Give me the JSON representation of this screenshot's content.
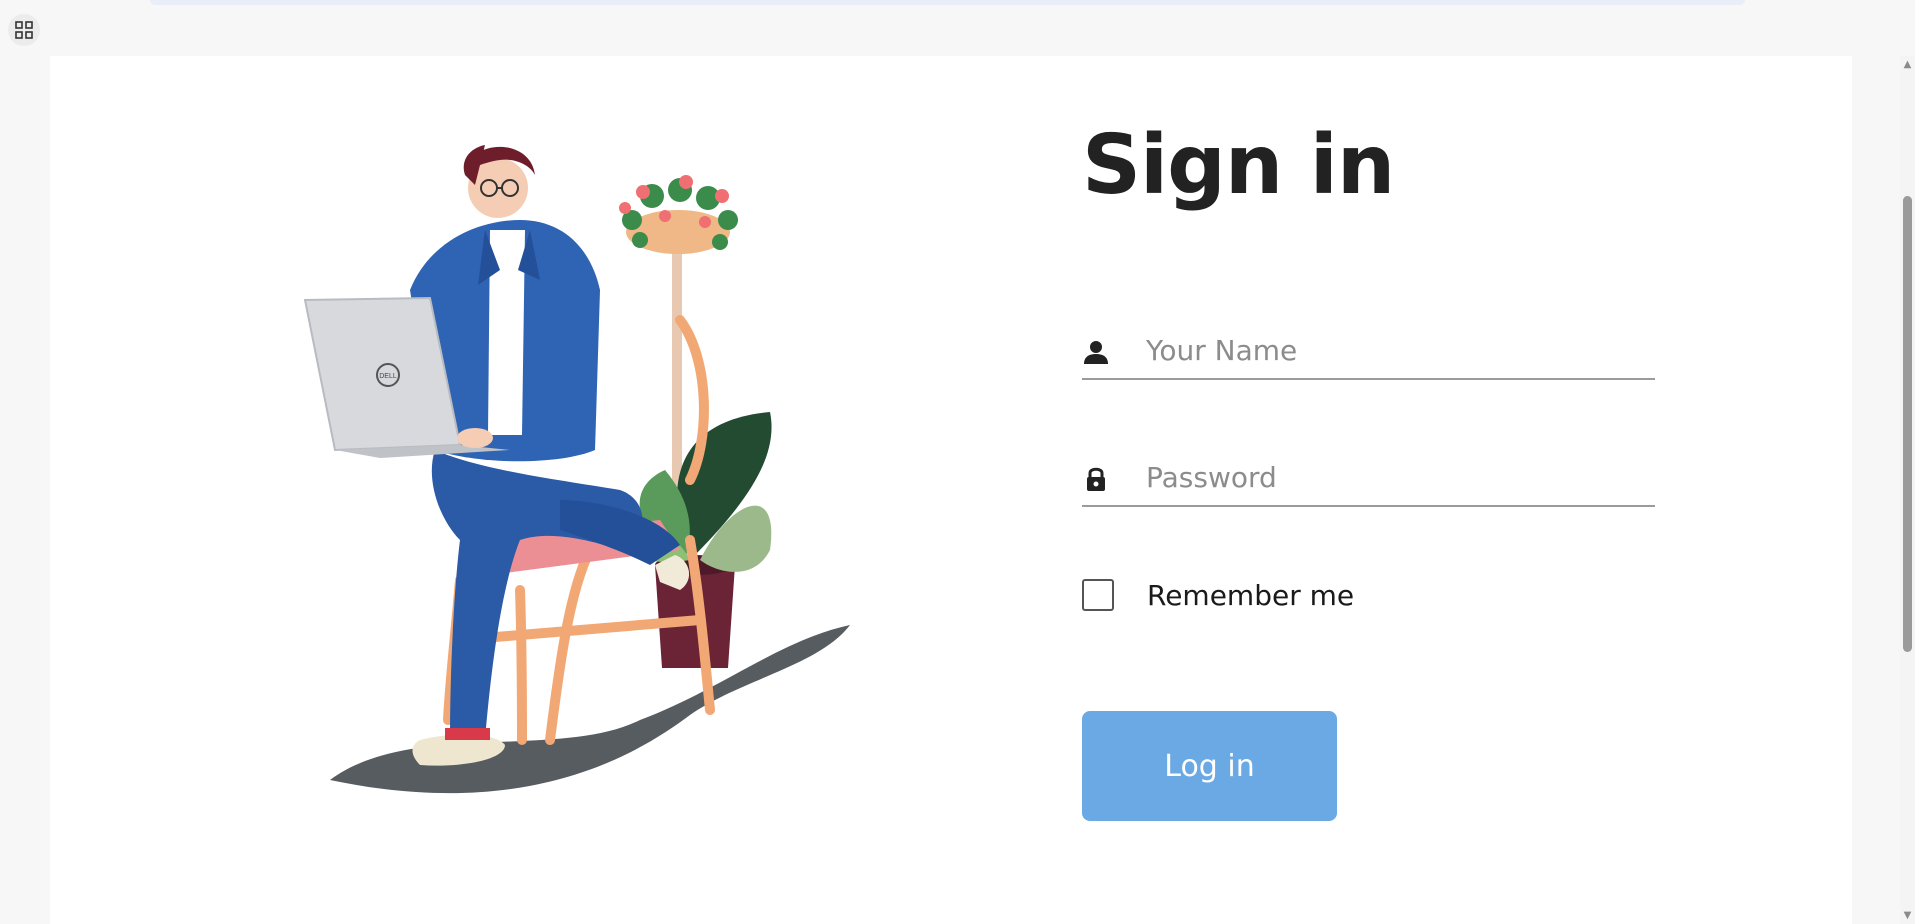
{
  "topbar": {
    "apps_icon": "grid-icon"
  },
  "signin": {
    "title": "Sign in",
    "name_placeholder": "Your Name",
    "name_icon": "user-icon",
    "password_placeholder": "Password",
    "password_icon": "lock-icon",
    "remember_label": "Remember me",
    "remember_checked": false,
    "login_label": "Log in"
  },
  "illustration": {
    "laptop_logo": "DELL"
  },
  "colors": {
    "button": "#6aa9e4",
    "title": "#222222",
    "underline": "#9b9b9b"
  }
}
